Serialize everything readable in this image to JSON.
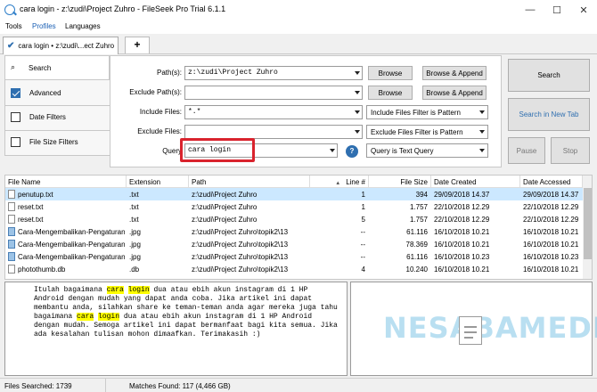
{
  "window": {
    "title": "cara login - z:\\zudi\\Project Zuhro - FileSeek Pro Trial 6.1.1",
    "minimize": "—",
    "maximize": "☐",
    "close": "✕"
  },
  "menu": [
    "Tools",
    "Profiles",
    "Languages"
  ],
  "tabs": {
    "active_label": "cara login • z:\\zudi\\...ect Zuhro",
    "add": "+"
  },
  "nav": {
    "search": "Search",
    "advanced": "Advanced",
    "date_filters": "Date Filters",
    "file_size_filters": "File Size Filters"
  },
  "form": {
    "paths_label": "Path(s):",
    "paths_value": "z:\\zudi\\Project Zuhro",
    "exclude_paths_label": "Exclude Path(s):",
    "exclude_paths_value": "",
    "include_files_label": "Include Files:",
    "include_files_value": "*.*",
    "exclude_files_label": "Exclude Files:",
    "exclude_files_value": "",
    "query_label": "Query",
    "query_value": "cara login",
    "browse": "Browse",
    "browse_append": "Browse & Append",
    "include_mode": "Include Files Filter is Pattern",
    "exclude_mode": "Exclude Files Filter is Pattern",
    "query_mode": "Query is Text Query",
    "help": "?"
  },
  "actions": {
    "search": "Search",
    "search_new_tab": "Search in New Tab",
    "pause": "Pause",
    "stop": "Stop"
  },
  "table": {
    "headers": {
      "name": "File Name",
      "ext": "Extension",
      "path": "Path",
      "line": "Line #",
      "size": "File Size",
      "created": "Date Created",
      "accessed": "Date Accessed",
      "sort_indicator": "▲"
    },
    "rows": [
      {
        "name": "penutup.txt",
        "ext": ".txt",
        "path": "z:\\zudi\\Project Zuhro",
        "line": "1",
        "size": "394",
        "created": "29/09/2018 14.37",
        "accessed": "29/09/2018 14.37"
      },
      {
        "name": "reset.txt",
        "ext": ".txt",
        "path": "z:\\zudi\\Project Zuhro",
        "line": "1",
        "size": "1.757",
        "created": "22/10/2018 12.29",
        "accessed": "22/10/2018 12.29"
      },
      {
        "name": "reset.txt",
        "ext": ".txt",
        "path": "z:\\zudi\\Project Zuhro",
        "line": "5",
        "size": "1.757",
        "created": "22/10/2018 12.29",
        "accessed": "22/10/2018 12.29"
      },
      {
        "name": "Cara-Mengembalikan-Pengaturan...",
        "ext": ".jpg",
        "path": "z:\\zudi\\Project Zuhro\\topik2\\13",
        "line": "--",
        "size": "61.116",
        "created": "16/10/2018 10.21",
        "accessed": "16/10/2018 10.21"
      },
      {
        "name": "Cara-Mengembalikan-Pengaturan...",
        "ext": ".jpg",
        "path": "z:\\zudi\\Project Zuhro\\topik2\\13",
        "line": "--",
        "size": "78.369",
        "created": "16/10/2018 10.21",
        "accessed": "16/10/2018 10.21"
      },
      {
        "name": "Cara-Mengembalikan-Pengaturan...",
        "ext": ".jpg",
        "path": "z:\\zudi\\Project Zuhro\\topik2\\13",
        "line": "--",
        "size": "61.116",
        "created": "16/10/2018 10.23",
        "accessed": "16/10/2018 10.23"
      },
      {
        "name": "photothumb.db",
        "ext": ".db",
        "path": "z:\\zudi\\Project Zuhro\\topik2\\13",
        "line": "4",
        "size": "10.240",
        "created": "16/10/2018 10.21",
        "accessed": "16/10/2018 10.21"
      }
    ]
  },
  "preview": {
    "t1": "Itulah bagaimana ",
    "m1": "cara",
    "t2": " ",
    "m2": "login",
    "t3": " dua atau ebih akun instagram di 1 HP Android dengan mudah yang dapat anda coba. Jika artikel ini dapat membantu anda, silahkan share ke teman-teman anda agar mereka juga tahu bagaimana ",
    "m3": "cara",
    "t4": " ",
    "m4": "login",
    "t5": " dua atau ebih akun instagram di 1 HP Android dengan mudah. Semoga artikel ini dapat bermanfaat bagi kita semua. Jika ada kesalahan tulisan mohon dimaafkan. Terimakasih :)"
  },
  "watermark": {
    "text": "NESABAMEDIA"
  },
  "status": {
    "searched": "Files Searched: 1739",
    "matches": "Matches Found: 117 (4,466 GB)"
  },
  "colors": {
    "highlight_box": "#d9232d",
    "selection": "#cce8ff",
    "accent": "#2f6fb0"
  }
}
